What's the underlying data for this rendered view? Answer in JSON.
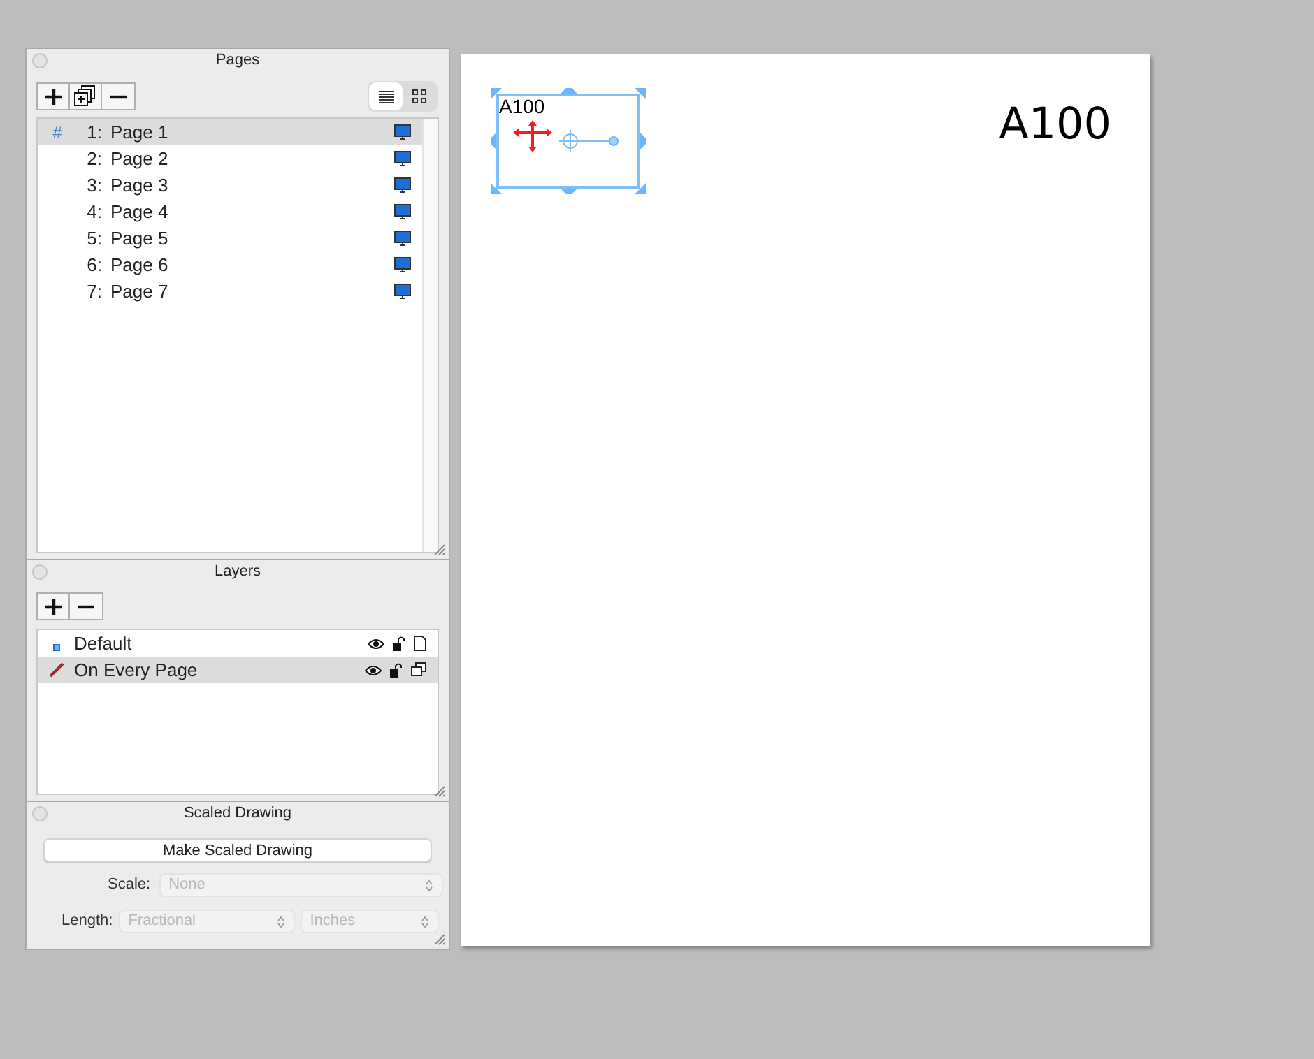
{
  "pages_panel": {
    "title": "Pages",
    "view_buttons": [
      {
        "kind": "list",
        "selected": true
      },
      {
        "kind": "grid",
        "selected": false
      }
    ],
    "pages": [
      {
        "number": "1:",
        "label": "Page 1",
        "marker": "#",
        "selected": true
      },
      {
        "number": "2:",
        "label": "Page 2",
        "selected": false
      },
      {
        "number": "3:",
        "label": "Page 3",
        "selected": false
      },
      {
        "number": "4:",
        "label": "Page 4",
        "selected": false
      },
      {
        "number": "5:",
        "label": "Page 5",
        "selected": false
      },
      {
        "number": "6:",
        "label": "Page 6",
        "selected": false
      },
      {
        "number": "7:",
        "label": "Page 7",
        "selected": false
      }
    ]
  },
  "layers_panel": {
    "title": "Layers",
    "layers": [
      {
        "name": "Default",
        "kind": "normal",
        "selected": false
      },
      {
        "name": "On Every Page",
        "kind": "shared",
        "selected": true
      }
    ]
  },
  "scaled_drawing": {
    "title": "Scaled Drawing",
    "button": "Make Scaled Drawing",
    "scale": {
      "label": "Scale:",
      "value": "None",
      "disabled": true
    },
    "length": {
      "label": "Length:",
      "format": "Fractional",
      "unit": "Inches",
      "disabled": true
    }
  },
  "canvas": {
    "title_text": "A100",
    "selected_text": "A100"
  }
}
